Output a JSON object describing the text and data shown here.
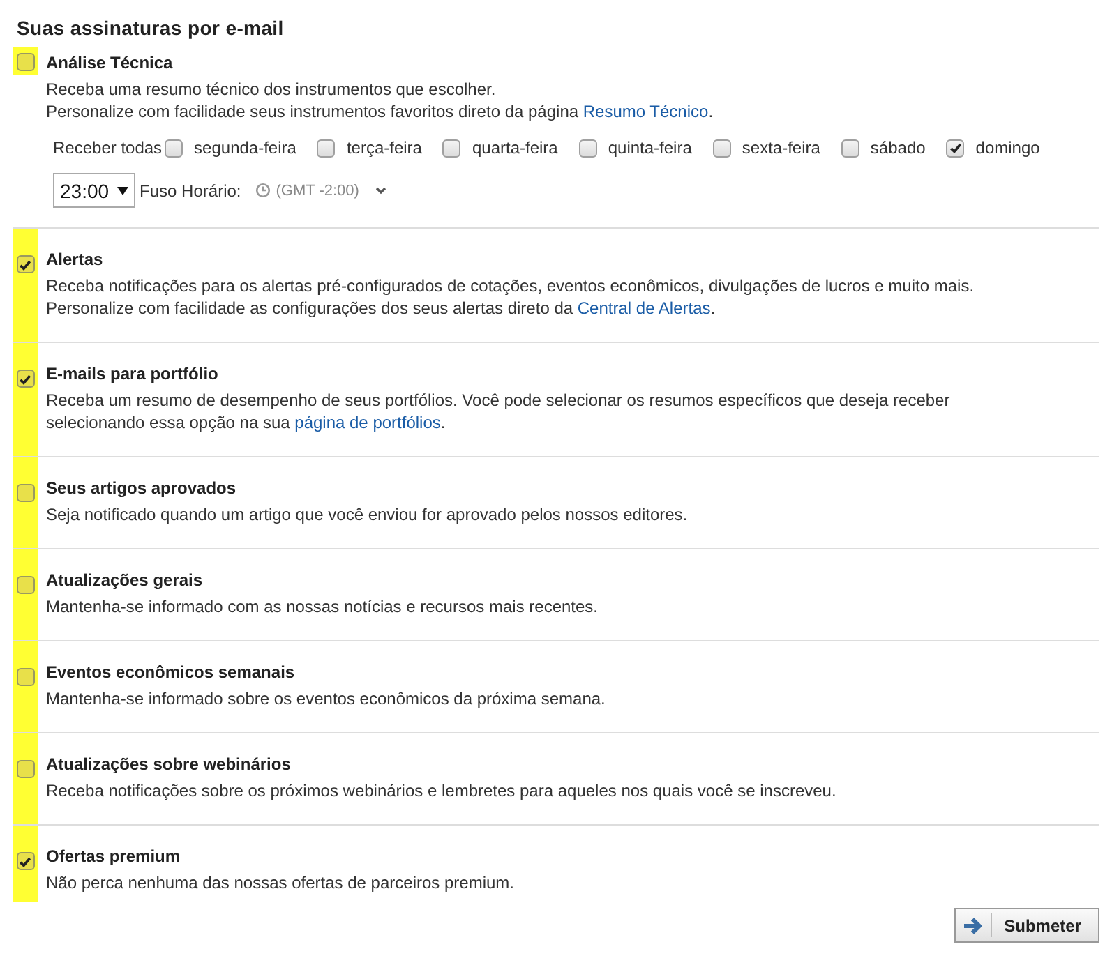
{
  "heading": "Suas assinaturas por e-mail",
  "subscriptions": [
    {
      "kind": "scheduled",
      "title": "Análise Técnica",
      "checked": false,
      "description": [
        [
          {
            "text": "Receba uma resumo técnico dos instrumentos que escolher."
          }
        ],
        [
          {
            "text": "Personalize com facilidade seus instrumentos favoritos direto da página "
          },
          {
            "link": "Resumo Técnico"
          },
          {
            "text": "."
          }
        ]
      ],
      "schedule": {
        "label": "Receber todas",
        "days": [
          {
            "label": "segunda-feira",
            "checked": false
          },
          {
            "label": "terça-feira",
            "checked": false
          },
          {
            "label": "quarta-feira",
            "checked": false
          },
          {
            "label": "quinta-feira",
            "checked": false
          },
          {
            "label": "sexta-feira",
            "checked": false
          },
          {
            "label": "sábado",
            "checked": false
          },
          {
            "label": "domingo",
            "checked": true
          }
        ],
        "time": "23:00",
        "timezone_label": "Fuso Horário:",
        "timezone": "(GMT -2:00)"
      }
    },
    {
      "kind": "simple",
      "title": "Alertas",
      "checked": true,
      "description": [
        [
          {
            "text": "Receba notificações para os alertas pré-configurados de cotações, eventos econômicos, divulgações de lucros e muito mais."
          }
        ],
        [
          {
            "text": "Personalize com facilidade as configurações dos seus alertas direto da "
          },
          {
            "link": "Central de Alertas"
          },
          {
            "text": "."
          }
        ]
      ]
    },
    {
      "kind": "simple",
      "title": "E-mails para portfólio",
      "checked": true,
      "description": [
        [
          {
            "text": "Receba um resumo de desempenho de seus portfólios. Você pode selecionar os resumos específicos que deseja receber"
          }
        ],
        [
          {
            "text": "selecionando essa opção na sua "
          },
          {
            "link": "página de portfólios"
          },
          {
            "text": "."
          }
        ]
      ]
    },
    {
      "kind": "simple",
      "title": "Seus artigos aprovados",
      "checked": false,
      "description": [
        [
          {
            "text": "Seja notificado quando um artigo que você enviou for aprovado pelos nossos editores."
          }
        ]
      ]
    },
    {
      "kind": "simple",
      "title": "Atualizações gerais",
      "checked": false,
      "description": [
        [
          {
            "text": "Mantenha-se informado com as nossas notícias e recursos mais recentes."
          }
        ]
      ]
    },
    {
      "kind": "simple",
      "title": "Eventos econômicos semanais",
      "checked": false,
      "description": [
        [
          {
            "text": "Mantenha-se informado sobre os eventos econômicos da próxima semana."
          }
        ]
      ]
    },
    {
      "kind": "simple",
      "title": "Atualizações sobre webinários",
      "checked": false,
      "description": [
        [
          {
            "text": "Receba notificações sobre os próximos webinários e lembretes para aqueles nos quais você se inscreveu."
          }
        ]
      ]
    },
    {
      "kind": "simple",
      "title": "Ofertas premium",
      "checked": true,
      "description": [
        [
          {
            "text": "Não perca nenhuma das nossas ofertas de parceiros premium."
          }
        ]
      ]
    }
  ],
  "submit": "Submeter"
}
